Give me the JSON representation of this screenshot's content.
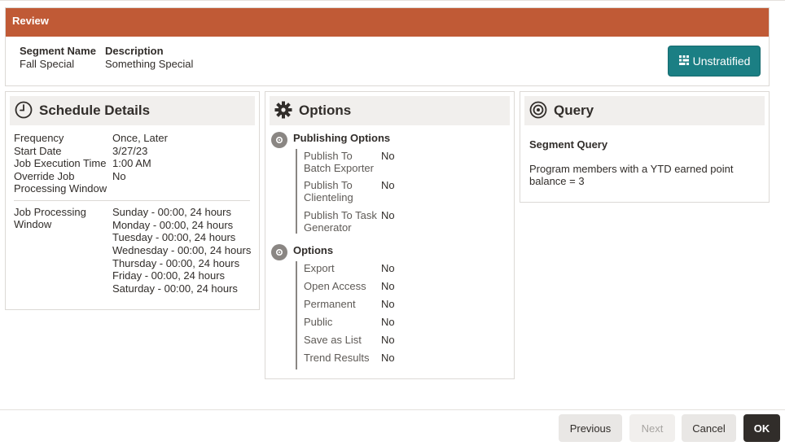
{
  "review": {
    "header": "Review",
    "segment_name_label": "Segment Name",
    "segment_name_value": "Fall Special",
    "description_label": "Description",
    "description_value": "Something Special",
    "unstratified_label": "Unstratified"
  },
  "schedule": {
    "title": "Schedule Details",
    "frequency_label": "Frequency",
    "frequency_value": "Once, Later",
    "start_date_label": "Start Date",
    "start_date_value": "3/27/23",
    "exec_time_label": "Job Execution Time",
    "exec_time_value": "1:00 AM",
    "override_label_1": "Override Job",
    "override_label_2": "Processing Window",
    "override_value": "No",
    "window_label_1": "Job Processing",
    "window_label_2": "Window",
    "window_values": [
      "Sunday - 00:00, 24 hours",
      "Monday - 00:00, 24 hours",
      "Tuesday - 00:00, 24 hours",
      "Wednesday - 00:00, 24 hours",
      "Thursday - 00:00, 24 hours",
      "Friday - 00:00, 24 hours",
      "Saturday - 00:00, 24 hours"
    ]
  },
  "options": {
    "title": "Options",
    "publishing_title": "Publishing Options",
    "publishing": [
      {
        "label_1": "Publish To",
        "label_2": "Batch Exporter",
        "value": "No"
      },
      {
        "label_1": "Publish To",
        "label_2": "Clienteling",
        "value": "No"
      },
      {
        "label_1": "Publish To Task",
        "label_2": "Generator",
        "value": "No"
      }
    ],
    "options_title": "Options",
    "items": [
      {
        "label": "Export",
        "value": "No"
      },
      {
        "label": "Open Access",
        "value": "No"
      },
      {
        "label": "Permanent",
        "value": "No"
      },
      {
        "label": "Public",
        "value": "No"
      },
      {
        "label": "Save as List",
        "value": "No"
      },
      {
        "label": "Trend Results",
        "value": "No"
      }
    ]
  },
  "query": {
    "title": "Query",
    "segment_query_label": "Segment Query",
    "text_1": "Program members with a YTD earned point",
    "text_2": "balance = 3"
  },
  "footer": {
    "previous": "Previous",
    "next": "Next",
    "cancel": "Cancel",
    "ok": "OK"
  },
  "icons": {
    "schedule": "clock-icon",
    "options": "gear-icon",
    "query": "target-icon",
    "unstratified": "grid-icon",
    "bullet": "gear-icon"
  },
  "colors": {
    "review_header": "#c05a36",
    "accent_button": "#1b7f84",
    "ok_button": "#312d2a"
  }
}
